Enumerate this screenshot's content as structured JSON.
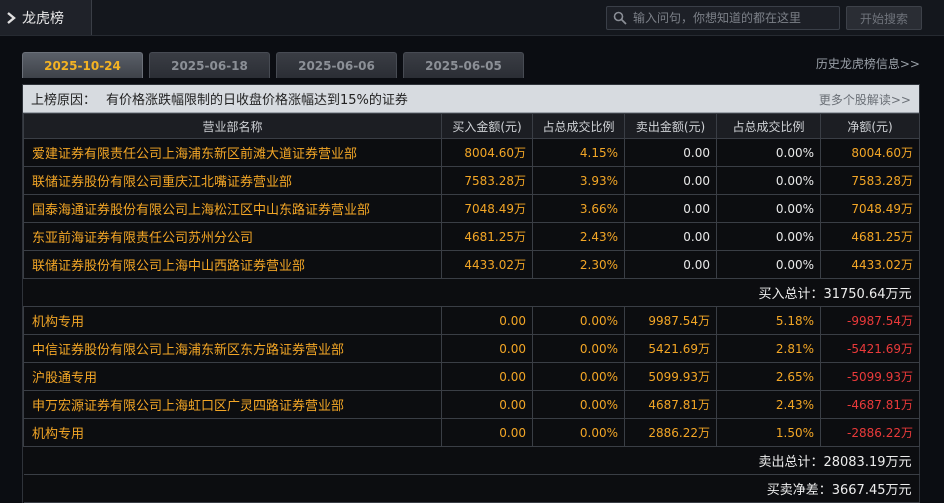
{
  "window": {
    "title": "龙虎榜"
  },
  "search": {
    "placeholder": "输入问句，你想知道的都在这里",
    "button_label": "开始搜索"
  },
  "tabs": [
    {
      "label": "2025-10-24",
      "active": true
    },
    {
      "label": "2025-06-18",
      "active": false
    },
    {
      "label": "2025-06-06",
      "active": false
    },
    {
      "label": "2025-06-05",
      "active": false
    }
  ],
  "history_link": "历史龙虎榜信息>>",
  "reason": {
    "key": "上榜原因：",
    "text": "有价格涨跌幅限制的日收盘价格涨幅达到15%的证券",
    "more_link": "更多个股解读>>"
  },
  "table": {
    "headers": [
      "营业部名称",
      "买入金额(元)",
      "占总成交比例",
      "卖出金额(元)",
      "占总成交比例",
      "净额(元)"
    ],
    "buy_rows": [
      {
        "name": "爱建证券有限责任公司上海浦东新区前滩大道证券营业部",
        "buy": "8004.60万",
        "buy_pct": "4.15%",
        "sell": "0.00",
        "sell_pct": "0.00%",
        "net": "8004.60万"
      },
      {
        "name": "联储证券股份有限公司重庆江北嘴证券营业部",
        "buy": "7583.28万",
        "buy_pct": "3.93%",
        "sell": "0.00",
        "sell_pct": "0.00%",
        "net": "7583.28万"
      },
      {
        "name": "国泰海通证券股份有限公司上海松江区中山东路证券营业部",
        "buy": "7048.49万",
        "buy_pct": "3.66%",
        "sell": "0.00",
        "sell_pct": "0.00%",
        "net": "7048.49万"
      },
      {
        "name": "东亚前海证券有限责任公司苏州分公司",
        "buy": "4681.25万",
        "buy_pct": "2.43%",
        "sell": "0.00",
        "sell_pct": "0.00%",
        "net": "4681.25万"
      },
      {
        "name": "联储证券股份有限公司上海中山西路证券营业部",
        "buy": "4433.02万",
        "buy_pct": "2.30%",
        "sell": "0.00",
        "sell_pct": "0.00%",
        "net": "4433.02万"
      }
    ],
    "buy_total": {
      "label": "买入总计：",
      "value": "31750.64万元"
    },
    "sell_rows": [
      {
        "name": "机构专用",
        "buy": "0.00",
        "buy_pct": "0.00%",
        "sell": "9987.54万",
        "sell_pct": "5.18%",
        "net": "-9987.54万"
      },
      {
        "name": "中信证券股份有限公司上海浦东新区东方路证券营业部",
        "buy": "0.00",
        "buy_pct": "0.00%",
        "sell": "5421.69万",
        "sell_pct": "2.81%",
        "net": "-5421.69万"
      },
      {
        "name": "沪股通专用",
        "buy": "0.00",
        "buy_pct": "0.00%",
        "sell": "5099.93万",
        "sell_pct": "2.65%",
        "net": "-5099.93万"
      },
      {
        "name": "申万宏源证券有限公司上海虹口区广灵四路证券营业部",
        "buy": "0.00",
        "buy_pct": "0.00%",
        "sell": "4687.81万",
        "sell_pct": "2.43%",
        "net": "-4687.81万"
      },
      {
        "name": "机构专用",
        "buy": "0.00",
        "buy_pct": "0.00%",
        "sell": "2886.22万",
        "sell_pct": "1.50%",
        "net": "-2886.22万"
      }
    ],
    "sell_total": {
      "label": "卖出总计：",
      "value": "28083.19万元"
    },
    "net_total": {
      "label": "买卖净差：",
      "value": "3667.45万元"
    }
  },
  "colors": {
    "accent": "#f3a626",
    "negative": "#ea3a3a",
    "reason_bg": "#d7dbe0"
  },
  "icons": {
    "chevron": "chevron-right-icon",
    "search": "search-icon"
  }
}
